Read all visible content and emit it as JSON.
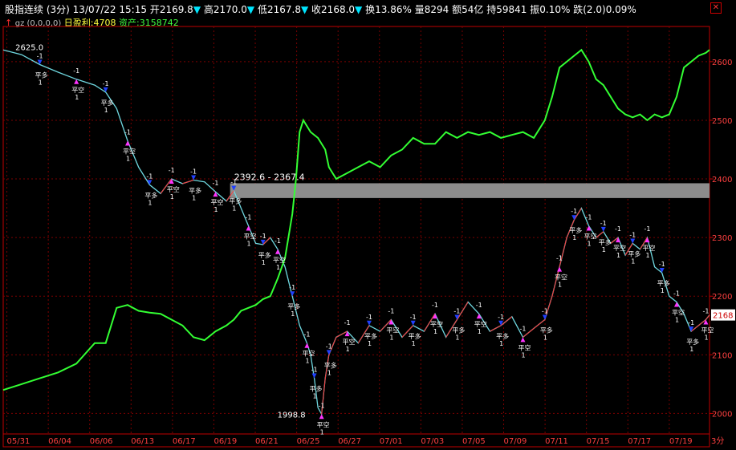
{
  "header": {
    "name": "股指连续",
    "period": "(3分)",
    "datetime": "13/07/22 15:15",
    "open_label": "开",
    "open": "2169.8",
    "high_label": "高",
    "high": "2170.0",
    "low_label": "低",
    "low": "2167.8",
    "close_label": "收",
    "close": "2168.0",
    "turnover_label": "换",
    "turnover": "13.86%",
    "volume_label": "量",
    "volume": "8294",
    "amount_label": "额",
    "amount": "54亿",
    "oi_label": "持",
    "oi": "59841",
    "amp_label": "振",
    "amp": "0.10%",
    "chg_label": "跌",
    "chg": "(2.0)",
    "chg_pct": "0.09%"
  },
  "indicator": {
    "formula": "gz (0,0,0,0)",
    "daily_profit_label": "日盈利:",
    "daily_profit": "4708",
    "assets_label": "资产:",
    "assets": "3158742"
  },
  "colors": {
    "price_up": "#ff3232",
    "price_down": "#00e5ff",
    "equity": "#33ff33",
    "axis": "#c00000",
    "grid": "#7a0000",
    "band": "#8c8c8c",
    "text": "#ffffff",
    "marker_magenta": "#ff33ff",
    "marker_red": "#ff2020",
    "marker_blue": "#2040ff",
    "marker_green": "#20e020"
  },
  "chart_data": {
    "type": "line",
    "x_tick_labels": [
      "05/31",
      "06/04",
      "06/06",
      "06/13",
      "06/17",
      "06/19",
      "06/21",
      "06/25",
      "06/27",
      "07/01",
      "07/03",
      "07/05",
      "07/09",
      "07/11",
      "07/15",
      "07/17",
      "07/19"
    ],
    "period_label": "3分",
    "y_ticks": [
      2000,
      2100,
      2200,
      2300,
      2400,
      2500,
      2600
    ],
    "ylim": [
      1965,
      2660
    ],
    "last_price": "2168",
    "annotations": {
      "high_marker": "2625.0",
      "low_marker": "1998.8",
      "band_text": "2392.6 - 2367.4",
      "band_range": [
        2367.4,
        2392.6
      ]
    },
    "trade_labels": [
      "-1",
      "平空",
      "开空",
      "平多",
      "开多",
      "1"
    ],
    "series": [
      {
        "values": [
          [
            0,
            2620
          ],
          [
            5,
            2612
          ],
          [
            10,
            2595
          ],
          [
            15,
            2582
          ],
          [
            20,
            2570
          ],
          [
            25,
            2560
          ],
          [
            28,
            2548
          ],
          [
            31,
            2520
          ],
          [
            34,
            2465
          ],
          [
            37,
            2420
          ],
          [
            40,
            2390
          ],
          [
            43,
            2375
          ],
          [
            46,
            2400
          ],
          [
            49,
            2392
          ],
          [
            52,
            2398
          ],
          [
            55,
            2395
          ],
          [
            58,
            2378
          ],
          [
            61,
            2362
          ],
          [
            63,
            2380
          ],
          [
            65,
            2350
          ],
          [
            67,
            2320
          ],
          [
            69,
            2290
          ],
          [
            71,
            2288
          ],
          [
            73,
            2300
          ],
          [
            75,
            2280
          ],
          [
            77,
            2250
          ],
          [
            79,
            2200
          ],
          [
            81,
            2150
          ],
          [
            83,
            2120
          ],
          [
            84,
            2100
          ],
          [
            85,
            2060
          ],
          [
            86,
            2010
          ],
          [
            87,
            1998.8
          ],
          [
            88,
            2060
          ],
          [
            89,
            2100
          ],
          [
            91,
            2130
          ],
          [
            94,
            2140
          ],
          [
            97,
            2120
          ],
          [
            100,
            2150
          ],
          [
            103,
            2140
          ],
          [
            106,
            2160
          ],
          [
            109,
            2130
          ],
          [
            112,
            2150
          ],
          [
            115,
            2140
          ],
          [
            118,
            2170
          ],
          [
            121,
            2130
          ],
          [
            124,
            2160
          ],
          [
            127,
            2190
          ],
          [
            130,
            2170
          ],
          [
            133,
            2140
          ],
          [
            136,
            2150
          ],
          [
            139,
            2165
          ],
          [
            142,
            2130
          ],
          [
            145,
            2145
          ],
          [
            148,
            2160
          ],
          [
            150,
            2200
          ],
          [
            152,
            2250
          ],
          [
            154,
            2300
          ],
          [
            156,
            2330
          ],
          [
            158,
            2350
          ],
          [
            160,
            2320
          ],
          [
            162,
            2300
          ],
          [
            164,
            2310
          ],
          [
            166,
            2290
          ],
          [
            168,
            2300
          ],
          [
            170,
            2270
          ],
          [
            172,
            2290
          ],
          [
            174,
            2280
          ],
          [
            176,
            2300
          ],
          [
            178,
            2250
          ],
          [
            180,
            2240
          ],
          [
            182,
            2200
          ],
          [
            184,
            2190
          ],
          [
            186,
            2170
          ],
          [
            188,
            2140
          ],
          [
            190,
            2150
          ],
          [
            192,
            2160
          ],
          [
            193,
            2168
          ]
        ]
      },
      {
        "values": [
          [
            0,
            2040
          ],
          [
            5,
            2050
          ],
          [
            10,
            2060
          ],
          [
            15,
            2070
          ],
          [
            20,
            2085
          ],
          [
            25,
            2120
          ],
          [
            28,
            2120
          ],
          [
            31,
            2180
          ],
          [
            34,
            2185
          ],
          [
            37,
            2175
          ],
          [
            40,
            2172
          ],
          [
            43,
            2170
          ],
          [
            46,
            2160
          ],
          [
            49,
            2150
          ],
          [
            52,
            2130
          ],
          [
            55,
            2125
          ],
          [
            58,
            2140
          ],
          [
            61,
            2150
          ],
          [
            63,
            2160
          ],
          [
            65,
            2175
          ],
          [
            67,
            2180
          ],
          [
            69,
            2185
          ],
          [
            71,
            2195
          ],
          [
            73,
            2200
          ],
          [
            75,
            2230
          ],
          [
            77,
            2265
          ],
          [
            79,
            2340
          ],
          [
            80,
            2400
          ],
          [
            81,
            2480
          ],
          [
            82,
            2500
          ],
          [
            84,
            2480
          ],
          [
            86,
            2470
          ],
          [
            88,
            2450
          ],
          [
            89,
            2420
          ],
          [
            91,
            2400
          ],
          [
            94,
            2410
          ],
          [
            97,
            2420
          ],
          [
            100,
            2430
          ],
          [
            103,
            2420
          ],
          [
            106,
            2440
          ],
          [
            109,
            2450
          ],
          [
            112,
            2470
          ],
          [
            115,
            2460
          ],
          [
            118,
            2460
          ],
          [
            121,
            2480
          ],
          [
            124,
            2470
          ],
          [
            127,
            2480
          ],
          [
            130,
            2475
          ],
          [
            133,
            2480
          ],
          [
            136,
            2470
          ],
          [
            139,
            2475
          ],
          [
            142,
            2480
          ],
          [
            145,
            2470
          ],
          [
            148,
            2500
          ],
          [
            150,
            2540
          ],
          [
            152,
            2590
          ],
          [
            154,
            2600
          ],
          [
            156,
            2610
          ],
          [
            158,
            2620
          ],
          [
            160,
            2600
          ],
          [
            162,
            2570
          ],
          [
            164,
            2560
          ],
          [
            166,
            2540
          ],
          [
            168,
            2520
          ],
          [
            170,
            2510
          ],
          [
            172,
            2505
          ],
          [
            174,
            2510
          ],
          [
            176,
            2500
          ],
          [
            178,
            2510
          ],
          [
            180,
            2505
          ],
          [
            182,
            2510
          ],
          [
            184,
            2540
          ],
          [
            186,
            2590
          ],
          [
            188,
            2600
          ],
          [
            190,
            2610
          ],
          [
            192,
            2615
          ],
          [
            193,
            2620
          ]
        ]
      }
    ],
    "grid": true
  }
}
